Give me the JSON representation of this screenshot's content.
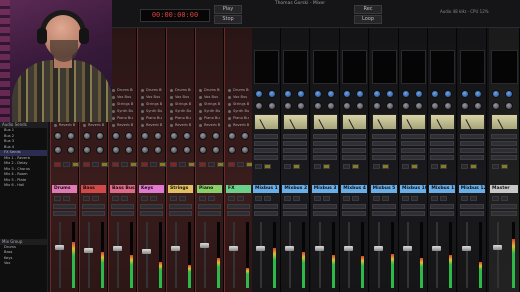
{
  "window": {
    "title": "Thomas Gorski - Mixer",
    "info": "Audio 48 kHz  ·  CPU 12%"
  },
  "toolbar": {
    "transport_display": "00:00:00:00",
    "buttons": [
      "Play",
      "Stop",
      "Rec",
      "Loop"
    ]
  },
  "browser": {
    "header": "Audio Sends",
    "items": [
      {
        "label": "Bus 1",
        "selected": false
      },
      {
        "label": "Bus 2",
        "selected": false
      },
      {
        "label": "Bus 3",
        "selected": false
      },
      {
        "label": "Bus 4",
        "selected": false
      },
      {
        "label": "FX Sends",
        "selected": true
      },
      {
        "label": "Mix 1 - Reverb",
        "selected": false
      },
      {
        "label": "Mix 2 - Delay",
        "selected": false
      },
      {
        "label": "Mix 3 - Chorus",
        "selected": false
      },
      {
        "label": "Mix 4 - Room",
        "selected": false
      },
      {
        "label": "Mix 5 - Plate",
        "selected": false
      },
      {
        "label": "Mix 6 - Hall",
        "selected": false
      }
    ],
    "footer_header": "Mix Group",
    "footer_items": [
      "Drums",
      "Bass",
      "Keys",
      "Vox"
    ]
  },
  "channels": [
    {
      "name": "Drums",
      "color": "#e07ab4",
      "type": "red",
      "sends": [
        "Drums Bus",
        "Vox Bus",
        "Strings Bus",
        "Synth Bus",
        "Piano Bus",
        "Reverb Bus"
      ],
      "fader": 0.62,
      "meter": 0.7
    },
    {
      "name": "Bass",
      "color": "#d04a4a",
      "type": "red",
      "sends": [
        "Drums Bus",
        "Vox Bus",
        "Strings Bus",
        "Synth Bus",
        "Piano Bus",
        "Reverb Bus"
      ],
      "fader": 0.58,
      "meter": 0.55
    },
    {
      "name": "Bass Bus",
      "color": "#e06a8a",
      "type": "red",
      "sends": [
        "Drums Bus",
        "Vox Bus",
        "Strings Bus",
        "Synth Bus",
        "Piano Bus",
        "Reverb Bus"
      ],
      "fader": 0.6,
      "meter": 0.5
    },
    {
      "name": "Keys",
      "color": "#e07ad0",
      "type": "red",
      "sends": [
        "Drums Bus",
        "Vox Bus",
        "Strings Bus",
        "Synth Bus",
        "Piano Bus",
        "Reverb Bus"
      ],
      "fader": 0.55,
      "meter": 0.4
    },
    {
      "name": "Strings",
      "color": "#e0c060",
      "type": "red",
      "sends": [
        "Drums Bus",
        "Vox Bus",
        "Strings Bus",
        "Synth Bus",
        "Piano Bus",
        "Reverb Bus"
      ],
      "fader": 0.6,
      "meter": 0.35
    },
    {
      "name": "Piano",
      "color": "#8ad06a",
      "type": "red",
      "sends": [
        "Drums Bus",
        "Vox Bus",
        "Strings Bus",
        "Synth Bus",
        "Piano Bus",
        "Reverb Bus"
      ],
      "fader": 0.65,
      "meter": 0.45
    },
    {
      "name": "FX",
      "color": "#6ad08a",
      "type": "red",
      "sends": [
        "Drums Bus",
        "Vox Bus",
        "Strings Bus",
        "Synth Bus",
        "Piano Bus",
        "Reverb Bus"
      ],
      "fader": 0.6,
      "meter": 0.3
    },
    {
      "name": "Mixbus 1",
      "color": "#6aaee8",
      "type": "blue",
      "fader": 0.6,
      "meter": 0.6
    },
    {
      "name": "Mixbus 2",
      "color": "#6aaee8",
      "type": "blue",
      "fader": 0.6,
      "meter": 0.55
    },
    {
      "name": "Mixbus 3",
      "color": "#6aaee8",
      "type": "blue",
      "fader": 0.6,
      "meter": 0.5
    },
    {
      "name": "Mixbus 4",
      "color": "#6aaee8",
      "type": "blue",
      "fader": 0.6,
      "meter": 0.48
    },
    {
      "name": "Mixbus 5",
      "color": "#6aaee8",
      "type": "blue",
      "fader": 0.6,
      "meter": 0.52
    },
    {
      "name": "Mixbus 10",
      "color": "#6aaee8",
      "type": "blue",
      "fader": 0.6,
      "meter": 0.45
    },
    {
      "name": "Mixbus 11",
      "color": "#6aaee8",
      "type": "blue",
      "fader": 0.6,
      "meter": 0.5
    },
    {
      "name": "Mixbus 12",
      "color": "#6aaee8",
      "type": "blue",
      "fader": 0.6,
      "meter": 0.4
    },
    {
      "name": "Master",
      "color": "#c8c8c8",
      "type": "master",
      "fader": 0.62,
      "meter": 0.75
    }
  ],
  "colors": {
    "red_strip": "#3a1c1c",
    "blue_strip": "#1a1a1e",
    "accent_blue": "#6aaee8"
  },
  "icons": [
    "plus-icon",
    "knob-icon",
    "vu-meter-icon"
  ]
}
